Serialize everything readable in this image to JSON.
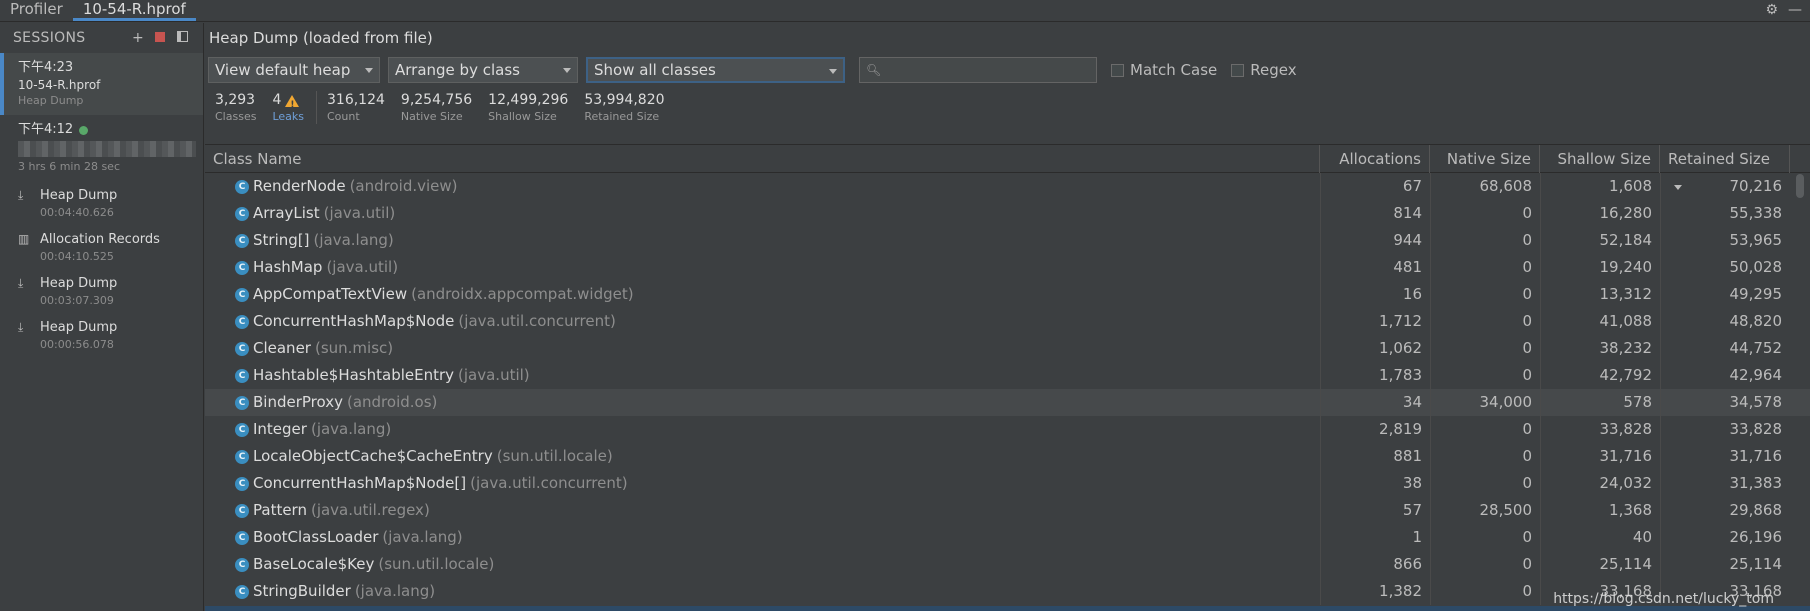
{
  "tabs": [
    {
      "label": "Profiler",
      "active": false
    },
    {
      "label": "10-54-R.hprof",
      "active": true
    }
  ],
  "top_icons": [
    "gear-icon",
    "minimize-icon"
  ],
  "sidebar": {
    "header": "SESSIONS",
    "sessions": [
      {
        "time": "下午4:23",
        "name": "10-54-R.hprof",
        "sub": "Heap Dump",
        "selected": true
      },
      {
        "time": "下午4:12",
        "sub": "3 hrs 6 min 28 sec",
        "live": true
      }
    ],
    "artifacts": [
      {
        "name": "Heap Dump",
        "time": "00:04:40.626",
        "icon": "heap-dump-icon"
      },
      {
        "name": "Allocation Records",
        "time": "00:04:10.525",
        "icon": "allocation-records-icon"
      },
      {
        "name": "Heap Dump",
        "time": "00:03:07.309",
        "icon": "heap-dump-icon"
      },
      {
        "name": "Heap Dump",
        "time": "00:00:56.078",
        "icon": "heap-dump-icon"
      }
    ]
  },
  "main": {
    "title": "Heap Dump (loaded from file)",
    "heap_select": "View default heap",
    "arrange_select": "Arrange by class",
    "filter_select": "Show all classes",
    "search_placeholder": "",
    "match_case": "Match Case",
    "regex": "Regex",
    "stats": {
      "classes": {
        "value": "3,293",
        "label": "Classes"
      },
      "leaks": {
        "value": "4",
        "label": "Leaks"
      },
      "count": {
        "value": "316,124",
        "label": "Count"
      },
      "native": {
        "value": "9,254,756",
        "label": "Native Size"
      },
      "shallow": {
        "value": "12,499,296",
        "label": "Shallow Size"
      },
      "retained": {
        "value": "53,994,820",
        "label": "Retained Size"
      }
    }
  },
  "table": {
    "columns": [
      "Class Name",
      "Allocations",
      "Native Size",
      "Shallow Size",
      "Retained Size"
    ],
    "rows": [
      {
        "name": "RenderNode",
        "pkg": "(android.view)",
        "alloc": "67",
        "native": "68,608",
        "shallow": "1,608",
        "retained": "70,216"
      },
      {
        "name": "ArrayList",
        "pkg": "(java.util)",
        "alloc": "814",
        "native": "0",
        "shallow": "16,280",
        "retained": "55,338"
      },
      {
        "name": "String[]",
        "pkg": "(java.lang)",
        "alloc": "944",
        "native": "0",
        "shallow": "52,184",
        "retained": "53,965"
      },
      {
        "name": "HashMap",
        "pkg": "(java.util)",
        "alloc": "481",
        "native": "0",
        "shallow": "19,240",
        "retained": "50,028"
      },
      {
        "name": "AppCompatTextView",
        "pkg": "(androidx.appcompat.widget)",
        "alloc": "16",
        "native": "0",
        "shallow": "13,312",
        "retained": "49,295"
      },
      {
        "name": "ConcurrentHashMap$Node",
        "pkg": "(java.util.concurrent)",
        "alloc": "1,712",
        "native": "0",
        "shallow": "41,088",
        "retained": "48,820"
      },
      {
        "name": "Cleaner",
        "pkg": "(sun.misc)",
        "alloc": "1,062",
        "native": "0",
        "shallow": "38,232",
        "retained": "44,752"
      },
      {
        "name": "Hashtable$HashtableEntry",
        "pkg": "(java.util)",
        "alloc": "1,783",
        "native": "0",
        "shallow": "42,792",
        "retained": "42,964"
      },
      {
        "name": "BinderProxy",
        "pkg": "(android.os)",
        "alloc": "34",
        "native": "34,000",
        "shallow": "578",
        "retained": "34,578"
      },
      {
        "name": "Integer",
        "pkg": "(java.lang)",
        "alloc": "2,819",
        "native": "0",
        "shallow": "33,828",
        "retained": "33,828"
      },
      {
        "name": "LocaleObjectCache$CacheEntry",
        "pkg": "(sun.util.locale)",
        "alloc": "881",
        "native": "0",
        "shallow": "31,716",
        "retained": "31,716"
      },
      {
        "name": "ConcurrentHashMap$Node[]",
        "pkg": "(java.util.concurrent)",
        "alloc": "38",
        "native": "0",
        "shallow": "24,032",
        "retained": "31,383"
      },
      {
        "name": "Pattern",
        "pkg": "(java.util.regex)",
        "alloc": "57",
        "native": "28,500",
        "shallow": "1,368",
        "retained": "29,868"
      },
      {
        "name": "BootClassLoader",
        "pkg": "(java.lang)",
        "alloc": "1",
        "native": "0",
        "shallow": "40",
        "retained": "26,196"
      },
      {
        "name": "BaseLocale$Key",
        "pkg": "(sun.util.locale)",
        "alloc": "866",
        "native": "0",
        "shallow": "25,114",
        "retained": "25,114"
      },
      {
        "name": "StringBuilder",
        "pkg": "(java.lang)",
        "alloc": "1,382",
        "native": "0",
        "shallow": "33,168",
        "retained": "33,168"
      }
    ]
  },
  "watermark": "https://blog.csdn.net/lucky_tom",
  "colors": {
    "accent": "#4a88c7",
    "class_icon": "#3a8ec0",
    "warning": "#f0a732",
    "live_dot": "#59a869",
    "stop": "#c75450"
  }
}
